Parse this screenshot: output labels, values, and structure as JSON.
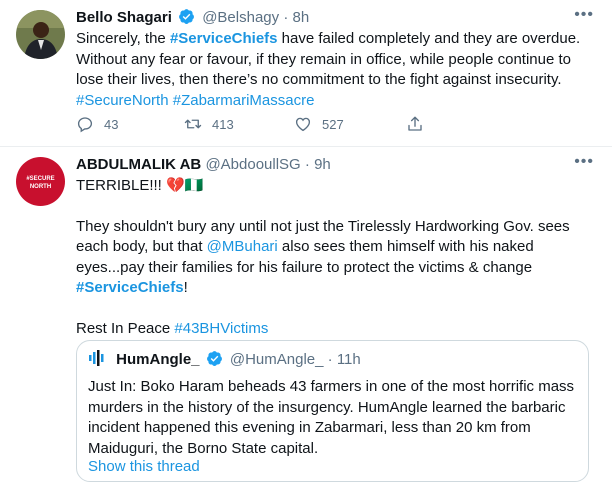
{
  "tweet1": {
    "name": "Bello Shagari",
    "handle": "@Belshagy",
    "dot": "·",
    "time": "8h",
    "text_part1": "Sincerely, the ",
    "tag_service_chiefs": "#ServiceChiefs",
    "text_part2": " have failed completely and they are overdue. Without any fear or favour, if they remain in office, while people continue to lose their lives, then there’s no commitment to the fight against insecurity.",
    "tag_secure_north": "#SecureNorth",
    "tag_zabarmari": "#ZabarmariMassacre",
    "reply_count": "43",
    "retweet_count": "413",
    "like_count": "527"
  },
  "tweet2": {
    "name": "ABDULMALIK AB",
    "handle": "@AbdooullSG",
    "dot": "·",
    "time": "9h",
    "avatar_text": "#SECURE NORTH",
    "line1": "TERRIBLE!!! 💔🇳🇬",
    "para2_part1": "They shouldn't bury any until not just the Tirelessly Hardworking Gov. sees each body, but that ",
    "mention": "@MBuhari",
    "para2_part2": " also sees them himself with his naked eyes...pay their families for his failure to protect the victims & change ",
    "tag_service_chiefs": "#ServiceChiefs",
    "para2_end": "!",
    "rip_text": "Rest In Peace ",
    "tag_43bh": "#43BHVictims"
  },
  "quote": {
    "name": "HumAngle_",
    "handle": "@HumAngle_",
    "dot": "·",
    "time": "11h",
    "text": "Just In: Boko Haram beheads 43 farmers in one of the most horrific mass murders in the history of the insurgency. HumAngle learned the barbaric incident happened this evening in Zabarmari, less than 20 km from Maiduguri, the Borno State capital.",
    "show_thread": "Show this thread"
  },
  "colors": {
    "accent": "#1b95e0",
    "text": "#0f1419",
    "muted": "#5b7083",
    "verified": "#1da1f2",
    "secure_north_red": "#c8102e"
  },
  "icons": [
    "verified-badge-icon",
    "more-icon",
    "reply-icon",
    "retweet-icon",
    "like-icon",
    "share-icon",
    "humangle-logo-icon"
  ]
}
